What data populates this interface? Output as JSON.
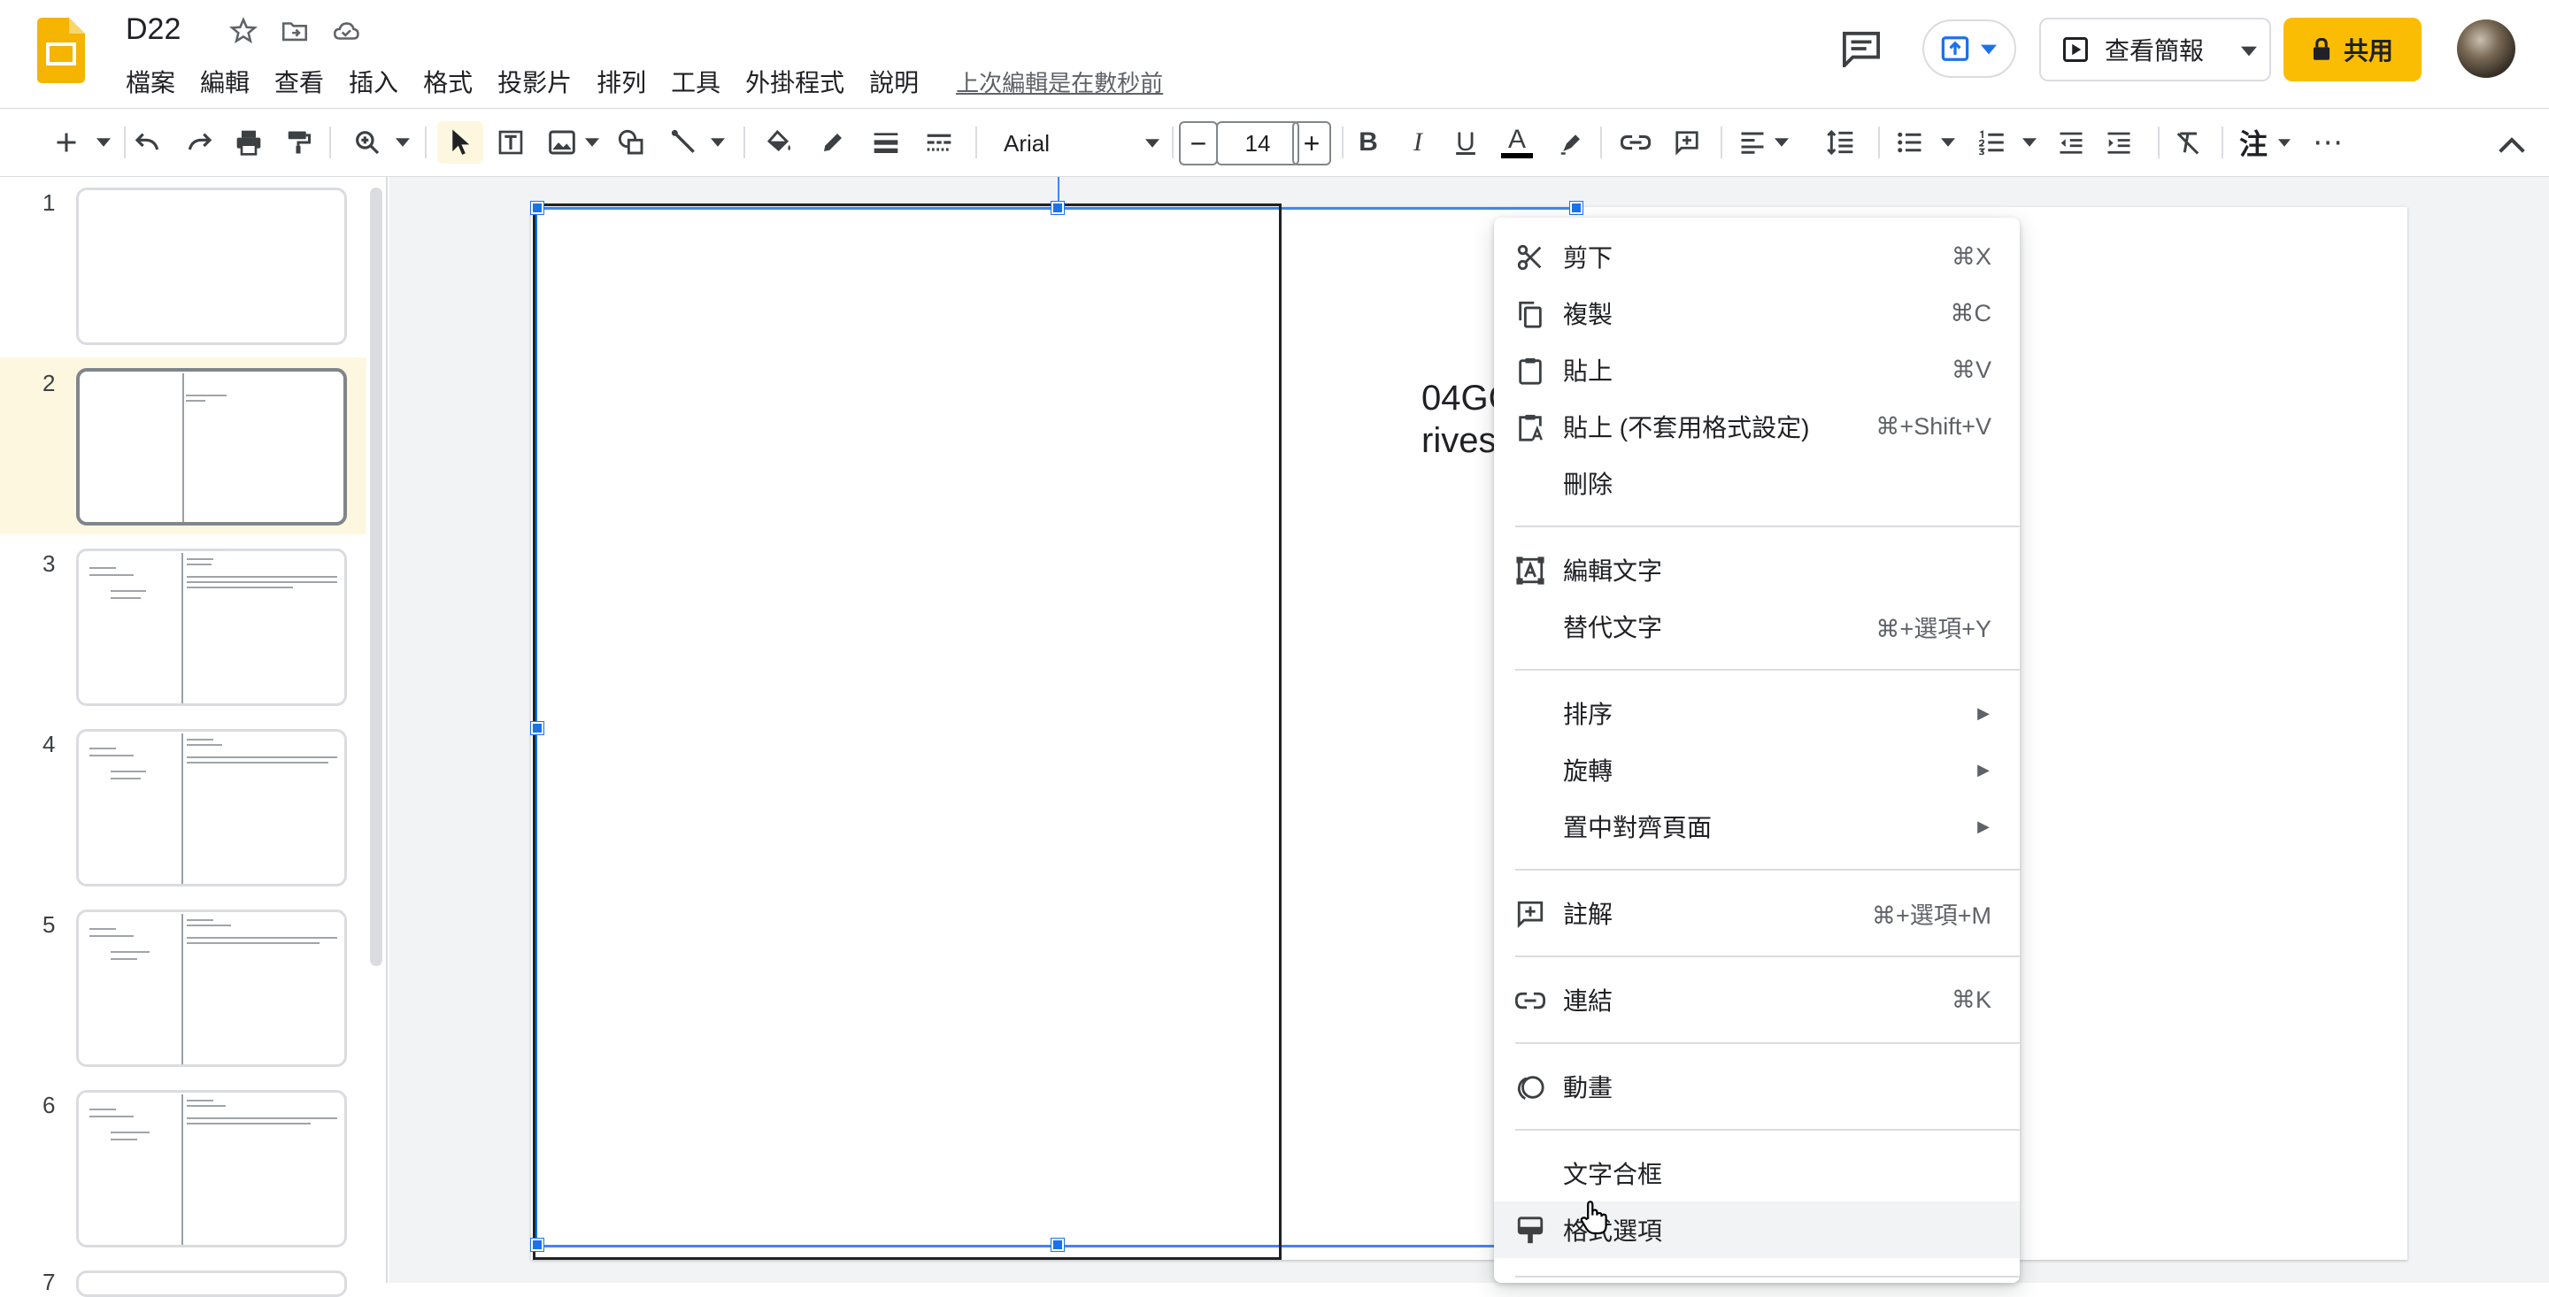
{
  "doc": {
    "title": "D22"
  },
  "menu": {
    "items": [
      "檔案",
      "編輯",
      "查看",
      "插入",
      "格式",
      "投影片",
      "排列",
      "工具",
      "外掛程式",
      "說明"
    ],
    "last_edit": "上次編輯是在數秒前"
  },
  "header": {
    "slideshow_label": "查看簡報",
    "share_label": "共用"
  },
  "toolbar": {
    "font_family": "Arial",
    "font_size": "14",
    "minus_label": "−",
    "plus_label": "+",
    "bold_label": "B",
    "italic_label": "I",
    "underline_label": "U",
    "text_color_label": "A",
    "zhuyin_label": "注",
    "more_label": "⋯"
  },
  "filmstrip": {
    "slides": [
      {
        "number": "1"
      },
      {
        "number": "2"
      },
      {
        "number": "3"
      },
      {
        "number": "4"
      },
      {
        "number": "5"
      },
      {
        "number": "6"
      },
      {
        "number": "7"
      }
    ],
    "active_index": 2
  },
  "slide": {
    "text_line1": "04GCBs2OCf",
    "text_line2": "rivesdk"
  },
  "context_menu": {
    "items": [
      {
        "icon": "scissors-icon",
        "label": "剪下",
        "shortcut": "⌘X"
      },
      {
        "icon": "copy-icon",
        "label": "複製",
        "shortcut": "⌘C"
      },
      {
        "icon": "clipboard-icon",
        "label": "貼上",
        "shortcut": "⌘V"
      },
      {
        "icon": "paste-plain-icon",
        "label": "貼上 (不套用格式設定)",
        "shortcut": "⌘+Shift+V"
      },
      {
        "icon": "",
        "label": "刪除",
        "shortcut": ""
      },
      {
        "icon": "edit-text-icon",
        "label": "編輯文字",
        "shortcut": ""
      },
      {
        "icon": "",
        "label": "替代文字",
        "shortcut": "⌘+選項+Y"
      },
      {
        "icon": "",
        "label": "排序",
        "shortcut": "",
        "submenu": true
      },
      {
        "icon": "",
        "label": "旋轉",
        "shortcut": "",
        "submenu": true
      },
      {
        "icon": "",
        "label": "置中對齊頁面",
        "shortcut": "",
        "submenu": true
      },
      {
        "icon": "add-comment-icon",
        "label": "註解",
        "shortcut": "⌘+選項+M"
      },
      {
        "icon": "link-icon",
        "label": "連結",
        "shortcut": "⌘K"
      },
      {
        "icon": "animation-icon",
        "label": "動畫",
        "shortcut": ""
      },
      {
        "icon": "",
        "label": "文字合框",
        "shortcut": ""
      },
      {
        "icon": "format-options-icon",
        "label": "格式選項",
        "shortcut": ""
      }
    ],
    "submenu_arrow": "▶"
  },
  "colors": {
    "brand_yellow": "#fbbc04",
    "selection_blue": "#1a73e8",
    "active_thumb_bg": "#fef7e0"
  }
}
